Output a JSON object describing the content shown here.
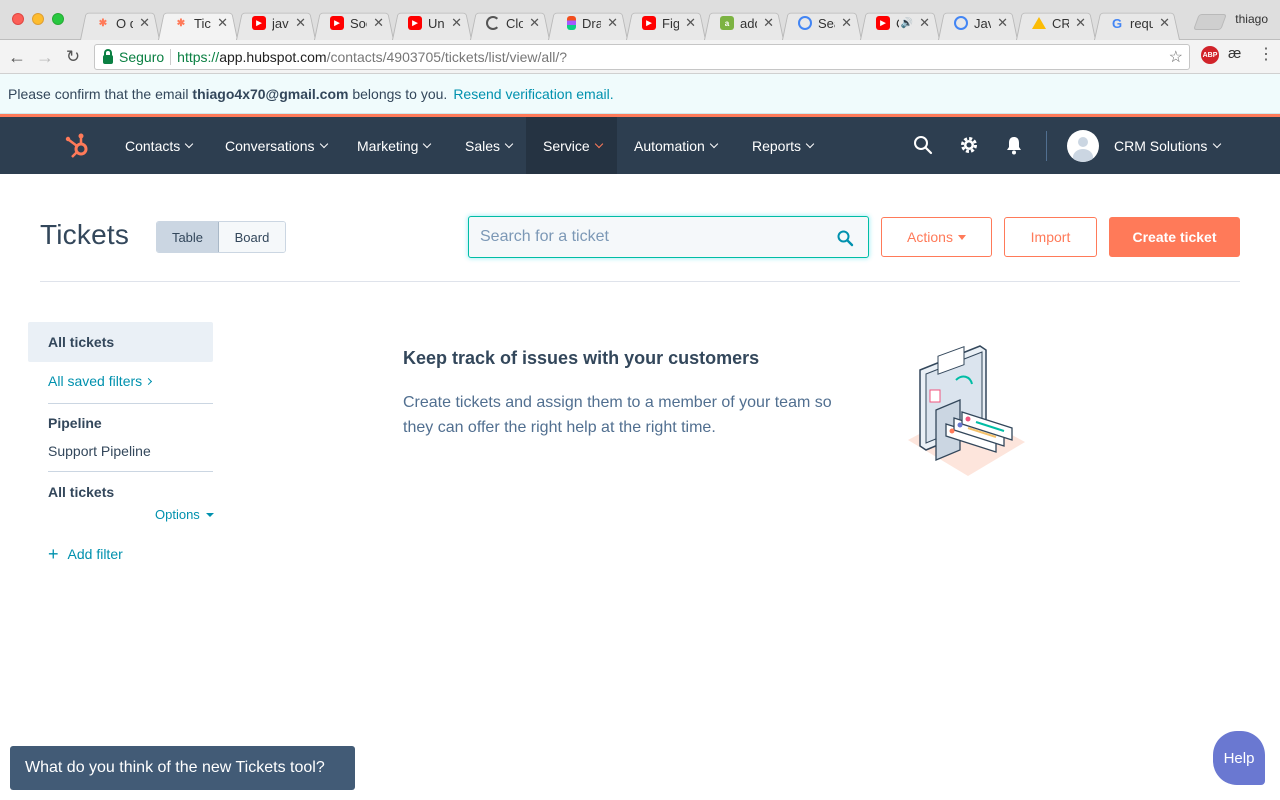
{
  "browser": {
    "profile_name": "thiago",
    "tabs": [
      {
        "title": "O qu",
        "favicon": "hubspot-sprocket",
        "color": "#ff7a59"
      },
      {
        "title": "Tick",
        "favicon": "hubspot-sprocket",
        "color": "#ff7a59",
        "active": true
      },
      {
        "title": "java",
        "favicon": "youtube-icon",
        "color": "#ff0000"
      },
      {
        "title": "Socl",
        "favicon": "youtube-icon",
        "color": "#ff0000"
      },
      {
        "title": "Univ",
        "favicon": "youtube-icon",
        "color": "#ff0000"
      },
      {
        "title": "Clou",
        "favicon": "loading-spinner",
        "color": "#555555"
      },
      {
        "title": "Draf",
        "favicon": "figma-icon",
        "color": "#a259ff"
      },
      {
        "title": "Figm",
        "favicon": "youtube-icon",
        "color": "#ff0000"
      },
      {
        "title": "addi",
        "favicon": "android-icon",
        "color": "#7cb342"
      },
      {
        "title": "Sear",
        "favicon": "google-search-console",
        "color": "#4285f4"
      },
      {
        "title": "C",
        "favicon": "youtube-icon",
        "color": "#ff0000",
        "audio": true
      },
      {
        "title": "Java",
        "favicon": "google-search-console",
        "color": "#4285f4"
      },
      {
        "title": "CRM",
        "favicon": "google-drive-icon",
        "color": "#fbbc05"
      },
      {
        "title": "requ",
        "favicon": "google-icon",
        "color": "#4285f4"
      }
    ],
    "omnibox": {
      "secure_label": "Seguro",
      "url_protocol": "https://",
      "url_host": "app.hubspot.com",
      "url_path": "/contacts/4903705/tickets/list/view/all/?"
    },
    "extensions": {
      "abp": "ABP",
      "ae": "æ"
    }
  },
  "verification_bar": {
    "text_before": "Please confirm that the email",
    "email": "thiago4x70@gmail.com",
    "text_after": "belongs to you.",
    "link": "Resend verification email."
  },
  "nav": {
    "items": [
      {
        "label": "Contacts"
      },
      {
        "label": "Conversations"
      },
      {
        "label": "Marketing"
      },
      {
        "label": "Sales"
      },
      {
        "label": "Service",
        "active": true
      },
      {
        "label": "Automation"
      },
      {
        "label": "Reports"
      }
    ],
    "account_name": "CRM Solutions",
    "accent_color": "#ff7a59",
    "background_color": "#2d3e50"
  },
  "page": {
    "title": "Tickets",
    "view_toggle": {
      "table": "Table",
      "board": "Board",
      "selected": "Table"
    },
    "search_placeholder": "Search for a ticket",
    "actions_label": "Actions",
    "import_label": "Import",
    "create_label": "Create ticket"
  },
  "sidebar": {
    "active_view": "All tickets",
    "saved_filters": "All saved filters",
    "pipeline_label": "Pipeline",
    "pipeline_value": "Support Pipeline",
    "current_view": "All tickets",
    "options_label": "Options",
    "add_filter": "Add filter"
  },
  "empty_state": {
    "title": "Keep track of issues with your customers",
    "description": "Create tickets and assign them to a member of your team so they can offer the right help at the right time."
  },
  "feedback_prompt": "What do you think of the new Tickets tool?",
  "help_label": "Help"
}
